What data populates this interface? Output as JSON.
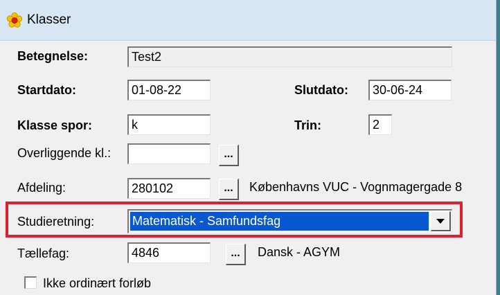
{
  "window": {
    "title": "Klasser",
    "icon": "flower-icon"
  },
  "form": {
    "betegnelse": {
      "label": "Betegnelse:",
      "value": "Test2"
    },
    "startdato": {
      "label": "Startdato:",
      "value": "01-08-22"
    },
    "slutdato": {
      "label": "Slutdato:",
      "value": "30-06-24"
    },
    "klasse_spor": {
      "label": "Klasse spor:",
      "value": "k"
    },
    "trin": {
      "label": "Trin:",
      "value": "2"
    },
    "overliggende": {
      "label": "Overliggende kl.:",
      "value": "",
      "button_label": "..."
    },
    "afdeling": {
      "label": "Afdeling:",
      "value": "280102",
      "button_label": "...",
      "description": "Københavns VUC - Vognmagergade 8"
    },
    "studieretning": {
      "label": "Studieretning:",
      "selected": "Matematisk - Samfundsfag"
    },
    "taellefag": {
      "label": "Tællefag:",
      "value": "4846",
      "button_label": "...",
      "description": "Dansk - AGYM"
    },
    "ikke_ordinaert": {
      "label": "Ikke ordinært forløb",
      "checked": false
    }
  },
  "colors": {
    "highlight": "#e0202c",
    "selection": "#0a58d0",
    "titlebar": "#d8e6f4",
    "background": "#3d7f86"
  }
}
